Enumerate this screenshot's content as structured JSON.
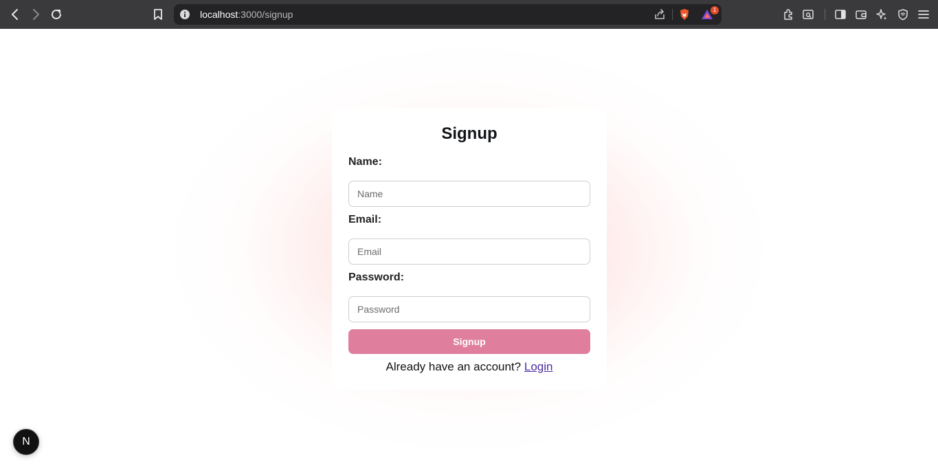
{
  "browser": {
    "url_host": "localhost",
    "url_path": ":3000/signup",
    "notification_count": "1"
  },
  "form": {
    "title": "Signup",
    "name_label": "Name:",
    "name_placeholder": "Name",
    "email_label": "Email:",
    "email_placeholder": "Email",
    "password_label": "Password:",
    "password_placeholder": "Password",
    "submit_label": "Signup",
    "login_prompt": "Already have an account?",
    "login_link": "Login"
  },
  "dev_indicator": {
    "label": "N"
  },
  "colors": {
    "button": "#e07f9d",
    "link": "#4b2aa0",
    "glow": "#ffaaaa"
  }
}
